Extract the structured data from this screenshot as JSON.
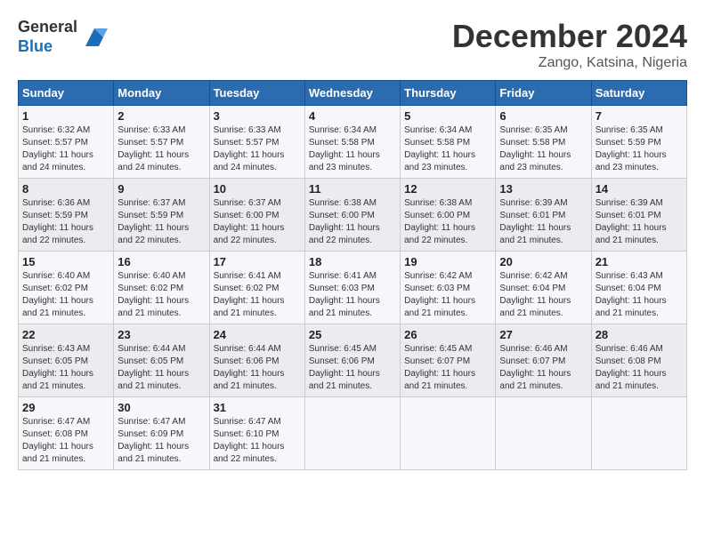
{
  "header": {
    "logo_general": "General",
    "logo_blue": "Blue",
    "main_title": "December 2024",
    "subtitle": "Zango, Katsina, Nigeria"
  },
  "calendar": {
    "days_of_week": [
      "Sunday",
      "Monday",
      "Tuesday",
      "Wednesday",
      "Thursday",
      "Friday",
      "Saturday"
    ],
    "weeks": [
      [
        {
          "day": "",
          "info": ""
        },
        {
          "day": "2",
          "info": "Sunrise: 6:33 AM\nSunset: 5:57 PM\nDaylight: 11 hours\nand 24 minutes."
        },
        {
          "day": "3",
          "info": "Sunrise: 6:33 AM\nSunset: 5:57 PM\nDaylight: 11 hours\nand 24 minutes."
        },
        {
          "day": "4",
          "info": "Sunrise: 6:34 AM\nSunset: 5:58 PM\nDaylight: 11 hours\nand 23 minutes."
        },
        {
          "day": "5",
          "info": "Sunrise: 6:34 AM\nSunset: 5:58 PM\nDaylight: 11 hours\nand 23 minutes."
        },
        {
          "day": "6",
          "info": "Sunrise: 6:35 AM\nSunset: 5:58 PM\nDaylight: 11 hours\nand 23 minutes."
        },
        {
          "day": "7",
          "info": "Sunrise: 6:35 AM\nSunset: 5:59 PM\nDaylight: 11 hours\nand 23 minutes."
        }
      ],
      [
        {
          "day": "1",
          "info": "Sunrise: 6:32 AM\nSunset: 5:57 PM\nDaylight: 11 hours\nand 24 minutes."
        },
        {
          "day": "",
          "info": ""
        },
        {
          "day": "",
          "info": ""
        },
        {
          "day": "",
          "info": ""
        },
        {
          "day": "",
          "info": ""
        },
        {
          "day": "",
          "info": ""
        },
        {
          "day": "",
          "info": ""
        }
      ],
      [
        {
          "day": "8",
          "info": "Sunrise: 6:36 AM\nSunset: 5:59 PM\nDaylight: 11 hours\nand 22 minutes."
        },
        {
          "day": "9",
          "info": "Sunrise: 6:37 AM\nSunset: 5:59 PM\nDaylight: 11 hours\nand 22 minutes."
        },
        {
          "day": "10",
          "info": "Sunrise: 6:37 AM\nSunset: 6:00 PM\nDaylight: 11 hours\nand 22 minutes."
        },
        {
          "day": "11",
          "info": "Sunrise: 6:38 AM\nSunset: 6:00 PM\nDaylight: 11 hours\nand 22 minutes."
        },
        {
          "day": "12",
          "info": "Sunrise: 6:38 AM\nSunset: 6:00 PM\nDaylight: 11 hours\nand 22 minutes."
        },
        {
          "day": "13",
          "info": "Sunrise: 6:39 AM\nSunset: 6:01 PM\nDaylight: 11 hours\nand 21 minutes."
        },
        {
          "day": "14",
          "info": "Sunrise: 6:39 AM\nSunset: 6:01 PM\nDaylight: 11 hours\nand 21 minutes."
        }
      ],
      [
        {
          "day": "15",
          "info": "Sunrise: 6:40 AM\nSunset: 6:02 PM\nDaylight: 11 hours\nand 21 minutes."
        },
        {
          "day": "16",
          "info": "Sunrise: 6:40 AM\nSunset: 6:02 PM\nDaylight: 11 hours\nand 21 minutes."
        },
        {
          "day": "17",
          "info": "Sunrise: 6:41 AM\nSunset: 6:02 PM\nDaylight: 11 hours\nand 21 minutes."
        },
        {
          "day": "18",
          "info": "Sunrise: 6:41 AM\nSunset: 6:03 PM\nDaylight: 11 hours\nand 21 minutes."
        },
        {
          "day": "19",
          "info": "Sunrise: 6:42 AM\nSunset: 6:03 PM\nDaylight: 11 hours\nand 21 minutes."
        },
        {
          "day": "20",
          "info": "Sunrise: 6:42 AM\nSunset: 6:04 PM\nDaylight: 11 hours\nand 21 minutes."
        },
        {
          "day": "21",
          "info": "Sunrise: 6:43 AM\nSunset: 6:04 PM\nDaylight: 11 hours\nand 21 minutes."
        }
      ],
      [
        {
          "day": "22",
          "info": "Sunrise: 6:43 AM\nSunset: 6:05 PM\nDaylight: 11 hours\nand 21 minutes."
        },
        {
          "day": "23",
          "info": "Sunrise: 6:44 AM\nSunset: 6:05 PM\nDaylight: 11 hours\nand 21 minutes."
        },
        {
          "day": "24",
          "info": "Sunrise: 6:44 AM\nSunset: 6:06 PM\nDaylight: 11 hours\nand 21 minutes."
        },
        {
          "day": "25",
          "info": "Sunrise: 6:45 AM\nSunset: 6:06 PM\nDaylight: 11 hours\nand 21 minutes."
        },
        {
          "day": "26",
          "info": "Sunrise: 6:45 AM\nSunset: 6:07 PM\nDaylight: 11 hours\nand 21 minutes."
        },
        {
          "day": "27",
          "info": "Sunrise: 6:46 AM\nSunset: 6:07 PM\nDaylight: 11 hours\nand 21 minutes."
        },
        {
          "day": "28",
          "info": "Sunrise: 6:46 AM\nSunset: 6:08 PM\nDaylight: 11 hours\nand 21 minutes."
        }
      ],
      [
        {
          "day": "29",
          "info": "Sunrise: 6:47 AM\nSunset: 6:08 PM\nDaylight: 11 hours\nand 21 minutes."
        },
        {
          "day": "30",
          "info": "Sunrise: 6:47 AM\nSunset: 6:09 PM\nDaylight: 11 hours\nand 21 minutes."
        },
        {
          "day": "31",
          "info": "Sunrise: 6:47 AM\nSunset: 6:10 PM\nDaylight: 11 hours\nand 22 minutes."
        },
        {
          "day": "",
          "info": ""
        },
        {
          "day": "",
          "info": ""
        },
        {
          "day": "",
          "info": ""
        },
        {
          "day": "",
          "info": ""
        }
      ]
    ]
  }
}
